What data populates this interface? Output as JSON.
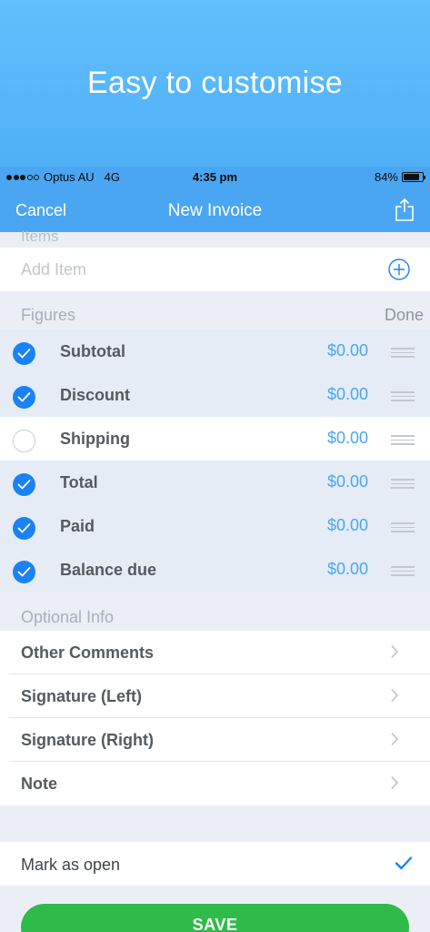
{
  "hero": {
    "title": "Easy to customise"
  },
  "status_bar": {
    "carrier": "Optus AU",
    "network": "4G",
    "time": "4:35 pm",
    "battery": "84%",
    "battery_level": 0.84
  },
  "nav": {
    "cancel": "Cancel",
    "title": "New Invoice",
    "share_icon": "share-icon"
  },
  "items_section": {
    "header": "Items",
    "add_item": "Add Item"
  },
  "figures": {
    "header": "Figures",
    "done": "Done",
    "rows": [
      {
        "label": "Subtotal",
        "value": "$0.00",
        "checked": true
      },
      {
        "label": "Discount",
        "value": "$0.00",
        "checked": true
      },
      {
        "label": "Shipping",
        "value": "$0.00",
        "checked": false
      },
      {
        "label": "Total",
        "value": "$0.00",
        "checked": true
      },
      {
        "label": "Paid",
        "value": "$0.00",
        "checked": true
      },
      {
        "label": "Balance due",
        "value": "$0.00",
        "checked": true
      }
    ]
  },
  "optional_info": {
    "header": "Optional Info",
    "rows": [
      {
        "label": "Other Comments"
      },
      {
        "label": "Signature  (Left)"
      },
      {
        "label": "Signature  (Right)"
      },
      {
        "label": "Note"
      }
    ]
  },
  "mark_open": {
    "label": "Mark as open",
    "checked": true
  },
  "save": {
    "label": "SAVE"
  },
  "colors": {
    "accent": "#4aa6f2",
    "check": "#1a82f4",
    "save": "#2fbb4a"
  }
}
